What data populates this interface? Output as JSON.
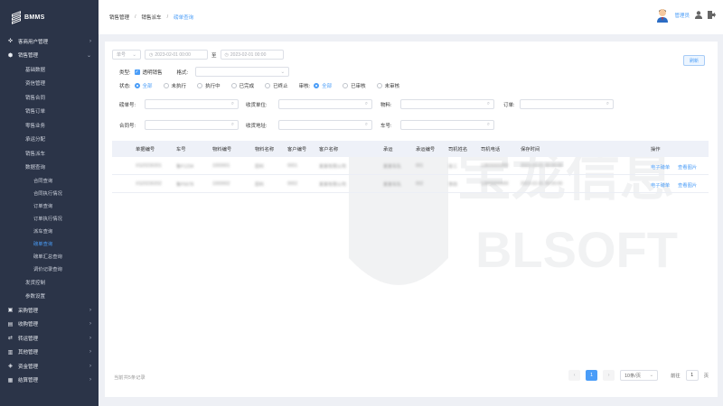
{
  "app": {
    "logo": "BMMS"
  },
  "sidebar": {
    "groups": [
      {
        "label": "客商用户管理",
        "icon": "crosshair-icon"
      },
      {
        "label": "销售管理",
        "icon": "cart-icon"
      }
    ],
    "sales_items": [
      "基础数据",
      "资信管理",
      "销售合同",
      "销售订单",
      "零售业务",
      "承运分配",
      "销售派车",
      "数据查询"
    ],
    "query_items": [
      "合同查询",
      "合同执行情况",
      "订单查询",
      "订单执行情况",
      "派车查询",
      "磅单查询",
      "磅单汇总查询",
      "调价记录查询"
    ],
    "active_query": "磅单查询",
    "tail_sales_items": [
      "发货控制",
      "参数设置"
    ],
    "bottom_groups": [
      {
        "label": "采购管理",
        "icon": "bag-icon"
      },
      {
        "label": "收购管理",
        "icon": "box-icon"
      },
      {
        "label": "转运管理",
        "icon": "transfer-icon"
      },
      {
        "label": "其他管理",
        "icon": "truck-icon"
      },
      {
        "label": "资金管理",
        "icon": "money-icon"
      },
      {
        "label": "结算管理",
        "icon": "settle-icon"
      }
    ]
  },
  "breadcrumb": [
    "销售管理",
    "销售派车",
    "磅单查询"
  ],
  "user": {
    "name": "管理员"
  },
  "filters": {
    "date_type": "单号",
    "date_start": "2023-02-01 00:00",
    "date_to": "至",
    "date_end": "2023-02-01 00:00",
    "refresh": "刷新",
    "type_label": "类型:",
    "type_option": "透明销售",
    "format_label": "格式:",
    "status_label": "状态:",
    "status_options": [
      "全部",
      "未执行",
      "执行中",
      "已完成",
      "已终止"
    ],
    "audit_label": "审核:",
    "audit_options": [
      "全部",
      "已审核",
      "未审核"
    ],
    "fields": {
      "bill_no": "磅单号:",
      "receiver": "收货单位:",
      "material": "物料:",
      "order": "订单:",
      "contract": "合同号:",
      "address": "收货地址:",
      "plate": "车号:"
    }
  },
  "table": {
    "headers": [
      "单据编号",
      "车号",
      "物料编号",
      "物料名称",
      "客户编号",
      "客户名称",
      "承运",
      "承运编号",
      "司机姓名",
      "司机电话",
      "保存时间",
      "操作"
    ],
    "rows": [
      {
        "cells": [
          "XS20230201",
          "鲁F1234",
          "1000001",
          "原料",
          "0001",
          "某某有限公司",
          "某某车队",
          "001",
          "张三",
          "13800000000",
          "2023-02-01 00:00:00"
        ],
        "actions": [
          "电子磅单",
          "查看图片"
        ]
      },
      {
        "cells": [
          "XS20230202",
          "鲁F5678",
          "1000002",
          "原料",
          "0002",
          "某某有限公司",
          "某某车队",
          "002",
          "李四",
          "13900000000",
          "2023-02-01 00:00:00"
        ],
        "actions": [
          "电子磅单",
          "查看图片"
        ]
      }
    ]
  },
  "footer": {
    "total": "当前共5条记录"
  },
  "pager": {
    "current": "1",
    "page_size": "10条/页",
    "goto": "前往",
    "goto_value": "1",
    "page_unit": "页"
  },
  "watermark": {
    "text": "BLSOFT"
  }
}
